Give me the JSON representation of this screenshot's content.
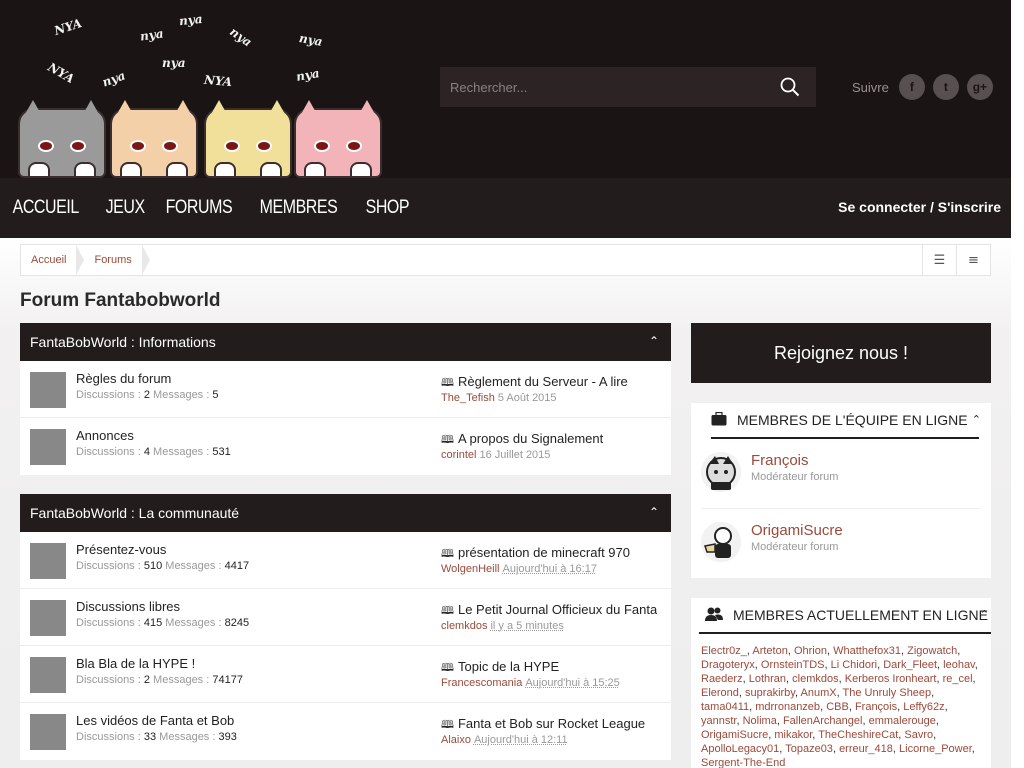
{
  "header": {
    "logo_nya_words": [
      "NYA",
      "nya",
      "nya",
      "nya",
      "nya",
      "NYA",
      "nya",
      "nya",
      "NYA",
      "nya"
    ],
    "search": {
      "placeholder": "Rechercher..."
    },
    "follow_label": "Suivre",
    "social": [
      {
        "icon": "facebook-icon",
        "glyph": "f"
      },
      {
        "icon": "twitter-icon",
        "glyph": "t"
      },
      {
        "icon": "google-plus-icon",
        "glyph": "g+"
      }
    ]
  },
  "nav": {
    "items": [
      "ACCUEIL",
      "JEUX",
      "FORUMS",
      "MEMBRES",
      "SHOP"
    ],
    "login": "Se connecter / S'inscrire"
  },
  "breadcrumb": {
    "items": [
      "Accueil",
      "Forums"
    ],
    "tools": [
      {
        "icon": "mark-read-icon",
        "glyph": "☰"
      },
      {
        "icon": "list-view-icon",
        "glyph": "≡"
      }
    ]
  },
  "page_title": "Forum Fantabobworld",
  "labels": {
    "discussions": "Discussions :",
    "messages": "Messages :"
  },
  "categories": [
    {
      "title": "FantaBobWorld : Informations",
      "forums": [
        {
          "name": "Règles du forum",
          "discussions": "2",
          "messages": "5",
          "last_title": "Règlement du Serveur - A lire",
          "last_user": "The_Tefish",
          "last_date": "5 Août 2015",
          "relative": false
        },
        {
          "name": "Annonces",
          "discussions": "4",
          "messages": "531",
          "last_title": "A propos du Signalement",
          "last_user": "corintel",
          "last_date": "16 Juillet 2015",
          "relative": false
        }
      ]
    },
    {
      "title": "FantaBobWorld : La communauté",
      "forums": [
        {
          "name": "Présentez-vous",
          "discussions": "510",
          "messages": "4417",
          "last_title": "présentation de minecraft 970",
          "last_user": "WolgenHeill",
          "last_date": "Aujourd'hui à 16:17",
          "relative": true
        },
        {
          "name": "Discussions libres",
          "discussions": "415",
          "messages": "8245",
          "last_title": "Le Petit Journal Officieux du Fanta",
          "last_user": "clemkdos",
          "last_date": "il y a 5 minutes",
          "relative": true
        },
        {
          "name": "Bla Bla de la HYPE !",
          "discussions": "2",
          "messages": "74177",
          "last_title": "Topic de la HYPE",
          "last_user": "Francescomania",
          "last_date": "Aujourd'hui à 15:25",
          "relative": true
        },
        {
          "name": "Les vidéos de Fanta et Bob",
          "discussions": "33",
          "messages": "393",
          "last_title": "Fanta et Bob sur Rocket League",
          "last_user": "Alaixo",
          "last_date": "Aujourd'hui à 12:11",
          "relative": true
        }
      ]
    }
  ],
  "sidebar": {
    "join_label": "Rejoignez nous !",
    "staff": {
      "title": "MEMBRES DE L'ÉQUIPE EN LIGNE",
      "members": [
        {
          "name": "François",
          "role": "Modérateur forum"
        },
        {
          "name": "OrigamiSucre",
          "role": "Modérateur forum"
        }
      ]
    },
    "online": {
      "title": "MEMBRES ACTUELLEMENT EN LIGNE",
      "members": [
        "Electr0z_",
        "Arteton",
        "Ohrion",
        "Whatthefox31",
        "Zigowatch",
        "Dragoteryx",
        "OrnsteinTDS",
        "Li Chidori",
        "Dark_Fleet",
        "leohav",
        "Raederz",
        "Lothran",
        "clemkdos",
        "Kerberos Ironheart",
        "re_cel",
        "Elerond",
        "suprakirby",
        "AnumX",
        "The Unruly Sheep",
        "tama0411",
        "mdrronanzeb",
        "CBB",
        "François",
        "Leffy62z",
        "yannstr",
        "Nolima",
        "FallenArchangel",
        "emmalerouge",
        "OrigamiSucre",
        "mikakor",
        "TheCheshireCat",
        "Savro",
        "ApolloLegacy01",
        "Topaze03",
        "erreur_418",
        "Licorne_Power",
        "Sergent-The-End"
      ]
    }
  }
}
